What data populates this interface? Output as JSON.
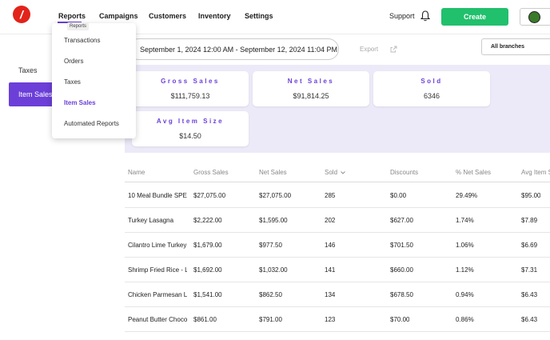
{
  "header": {
    "nav": [
      {
        "label": "Reports"
      },
      {
        "label": "Campaigns"
      },
      {
        "label": "Customers"
      },
      {
        "label": "Inventory"
      },
      {
        "label": "Settings"
      }
    ],
    "support_label": "Support",
    "create_label": "Create",
    "accent_color": "#6b3fd8",
    "create_color": "#21c06c",
    "logo_color": "#e2231a"
  },
  "sidebar": {
    "items": [
      {
        "label": "Taxes"
      },
      {
        "label": "Item Sales",
        "active": true
      }
    ]
  },
  "filters": {
    "date_range": "September 1, 2024 12:00 AM - September 12, 2024 11:04 PM",
    "export_label": "Export",
    "branch_select": "All branches"
  },
  "stats": [
    {
      "label": "Gross Sales",
      "value": "$111,759.13"
    },
    {
      "label": "Net Sales",
      "value": "$91,814.25"
    },
    {
      "label": "Sold",
      "value": "6346"
    },
    {
      "label": "Avg Item Size",
      "value": "$14.50"
    }
  ],
  "table": {
    "columns": [
      "Name",
      "Gross Sales",
      "Net Sales",
      "Sold",
      "Discounts",
      "% Net Sales",
      "Avg Item S"
    ],
    "sort_column": "Sold",
    "rows": [
      [
        "10 Meal Bundle SPECI",
        "$27,075.00",
        "$27,075.00",
        "285",
        "$0.00",
        "29.49%",
        "$95.00"
      ],
      [
        "Turkey Lasagna",
        "$2,222.00",
        "$1,595.00",
        "202",
        "$627.00",
        "1.74%",
        "$7.89"
      ],
      [
        "Cilantro Lime Turkey L",
        "$1,679.00",
        "$977.50",
        "146",
        "$701.50",
        "1.06%",
        "$6.69"
      ],
      [
        "Shrimp Fried Rice - La",
        "$1,692.00",
        "$1,032.00",
        "141",
        "$660.00",
        "1.12%",
        "$7.31"
      ],
      [
        "Chicken Parmesan Lar",
        "$1,541.00",
        "$862.50",
        "134",
        "$678.50",
        "0.94%",
        "$6.43"
      ],
      [
        "Peanut Butter Chocolá",
        "$861.00",
        "$791.00",
        "123",
        "$70.00",
        "0.86%",
        "$6.43"
      ]
    ]
  },
  "dropdown": {
    "tooltip": "Reports",
    "items": [
      {
        "label": "Transactions"
      },
      {
        "label": "Orders"
      },
      {
        "label": "Taxes"
      },
      {
        "label": "Item Sales",
        "active": true
      },
      {
        "label": "Automated Reports"
      }
    ]
  }
}
